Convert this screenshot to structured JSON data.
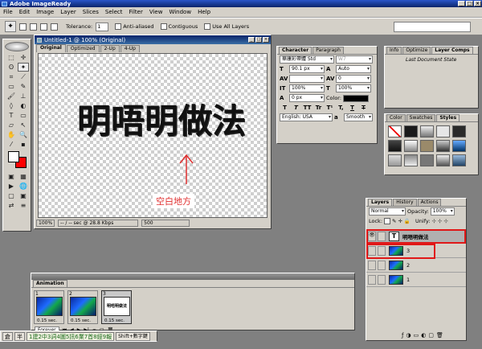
{
  "app": {
    "title": "Adobe ImageReady",
    "win_btns": [
      "_",
      "□",
      "×"
    ]
  },
  "menu": [
    "File",
    "Edit",
    "Image",
    "Layer",
    "Slices",
    "Select",
    "Filter",
    "View",
    "Window",
    "Help"
  ],
  "options": {
    "tolerance_label": "Tolerance:",
    "tolerance_value": "1",
    "anti_aliased": "Anti-aliased",
    "contiguous": "Contiguous",
    "use_all_layers": "Use All Layers"
  },
  "document": {
    "title": "Untitled-1 @ 100% (Original)",
    "tabs": [
      "Original",
      "Optimized",
      "2-Up",
      "4-Up"
    ],
    "canvas_text": "明唔明做法",
    "annotation_label": "空白地方",
    "zoom": "100%",
    "status": "-- / -- sec @ 28.8 Kbps",
    "size": "500"
  },
  "character": {
    "tabs": [
      "Character",
      "Paragraph"
    ],
    "font_family": "華康彩帶體 Std",
    "font_style": "W7",
    "font_size": "90.1 px",
    "leading": "Auto",
    "kerning": "",
    "tracking": "0",
    "vscale": "100%",
    "hscale": "100%",
    "baseline": "0 px",
    "color_label": "Color:",
    "format_buttons": [
      "T",
      "T",
      "TT",
      "Tr",
      "T¹",
      "T,",
      "T",
      "T"
    ],
    "language": "English: USA",
    "antialias": "Smooth"
  },
  "info_panel": {
    "tabs": [
      "Info",
      "Optimize",
      "Layer Comps"
    ],
    "state": "Last Document State"
  },
  "styles_panel": {
    "tabs": [
      "Color",
      "Swatches",
      "Styles"
    ]
  },
  "layers": {
    "tabs": [
      "Layers",
      "History",
      "Actions"
    ],
    "blend": "Normal",
    "opacity_label": "Opacity:",
    "opacity": "100%",
    "lock_label": "Lock:",
    "unify_label": "Unify:",
    "rows": [
      {
        "name": "明唔明做法",
        "type": "text"
      },
      {
        "name": "3",
        "type": "image"
      },
      {
        "name": "2",
        "type": "image"
      },
      {
        "name": "1",
        "type": "image"
      }
    ]
  },
  "animation": {
    "title": "Animation",
    "frames": [
      {
        "num": "1",
        "delay": "0.15 sec."
      },
      {
        "num": "2",
        "delay": "0.15 sec."
      },
      {
        "num": "3",
        "delay": "0.15 sec.",
        "text": "明唔明做法"
      }
    ],
    "loop": "Forever"
  },
  "ime": {
    "keys": [
      "倉",
      "半"
    ],
    "sequence": "1建2中3詞4圖5訊6業7首8經9報",
    "shortcut": "Shift+數字鍵"
  }
}
